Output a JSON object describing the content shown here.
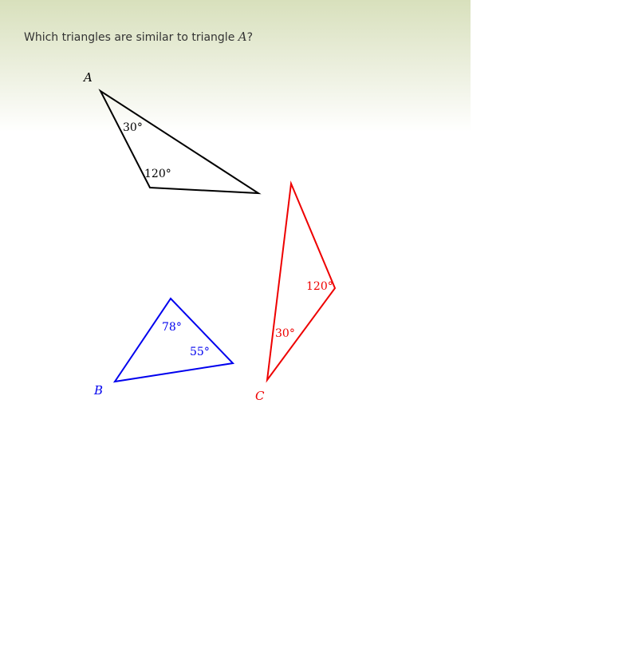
{
  "question": {
    "prefix": "Which triangles are similar to triangle ",
    "variable": "A",
    "suffix": "?"
  },
  "triangles": {
    "A": {
      "name": "A",
      "color": "#000000",
      "angles": [
        "30°",
        "120°"
      ]
    },
    "B": {
      "name": "B",
      "color": "#0000ee",
      "angles": [
        "78°",
        "55°"
      ]
    },
    "C": {
      "name": "C",
      "color": "#ee0000",
      "angles": [
        "120°",
        "30°"
      ]
    }
  }
}
